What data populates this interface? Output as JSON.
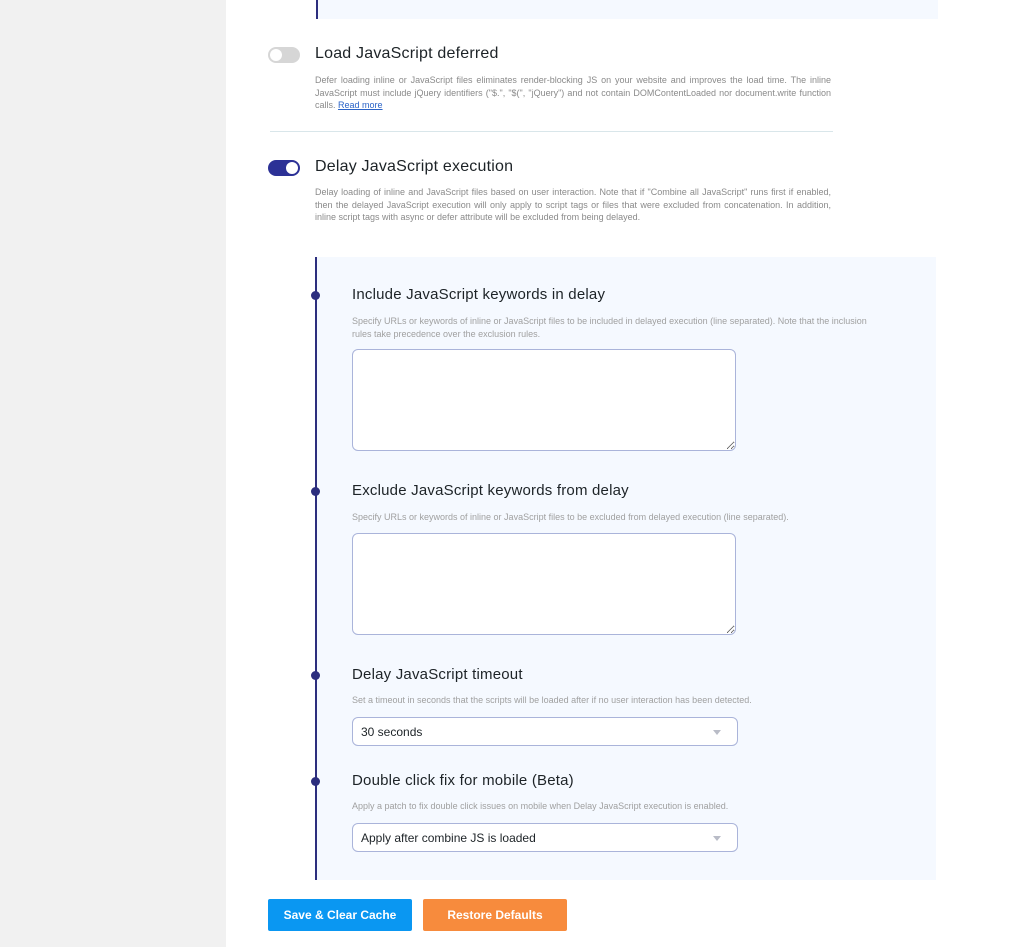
{
  "settings": {
    "deferred": {
      "title": "Load JavaScript deferred",
      "enabled": false,
      "description": "Defer loading inline or JavaScript files eliminates render-blocking JS on your website and improves the load time. The inline JavaScript must include jQuery identifiers (\"$.\", \"$(\", \"jQuery\") and not contain DOMContentLoaded nor document.write function calls.",
      "read_more": "Read more"
    },
    "delay": {
      "title": "Delay JavaScript execution",
      "enabled": true,
      "description": "Delay loading of inline and JavaScript files based on user interaction. Note that if \"Combine all JavaScript\" runs first if enabled, then the delayed JavaScript execution will only apply to script tags or files that were excluded from concatenation. In addition, inline script tags with async or defer attribute will be excluded from being delayed."
    }
  },
  "delay_options": {
    "include": {
      "title": "Include JavaScript keywords in delay",
      "description": "Specify URLs or keywords of inline or JavaScript files to be included in delayed execution (line separated). Note that the inclusion rules take precedence over the exclusion rules.",
      "value": ""
    },
    "exclude": {
      "title": "Exclude JavaScript keywords from delay",
      "description": "Specify URLs or keywords of inline or JavaScript files to be excluded from delayed execution (line separated).",
      "value": ""
    },
    "timeout": {
      "title": "Delay JavaScript timeout",
      "description": "Set a timeout in seconds that the scripts will be loaded after if no user interaction has been detected.",
      "selected": "30 seconds"
    },
    "double_click": {
      "title": "Double click fix for mobile (Beta)",
      "description": "Apply a patch to fix double click issues on mobile when Delay JavaScript execution is enabled.",
      "selected": "Apply after combine JS is loaded"
    }
  },
  "buttons": {
    "save": "Save & Clear Cache",
    "restore": "Restore Defaults"
  },
  "colors": {
    "accent": "#2c3196",
    "save_button": "#0a97f2",
    "restore_button": "#f78b3d"
  }
}
